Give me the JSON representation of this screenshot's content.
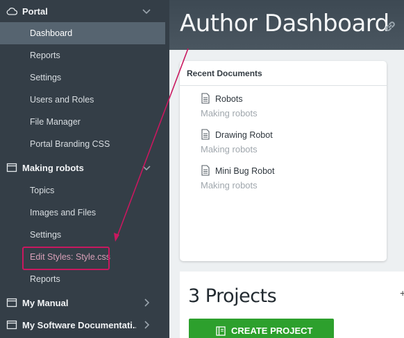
{
  "sidebar": {
    "sections": [
      {
        "label": "Portal",
        "icon": "cloud-icon",
        "expanded": true,
        "items": [
          "Dashboard",
          "Reports",
          "Settings",
          "Users and Roles",
          "File Manager",
          "Portal Branding CSS"
        ]
      },
      {
        "label": "Making robots",
        "icon": "book-icon",
        "expanded": true,
        "items": [
          "Topics",
          "Images and Files",
          "Settings",
          "Edit Styles: Style.css",
          "Reports"
        ]
      },
      {
        "label": "My Manual",
        "icon": "book-icon",
        "expanded": false,
        "items": []
      },
      {
        "label": "My Software Documentati...",
        "icon": "book-icon",
        "expanded": false,
        "items": []
      }
    ],
    "active_item": "Dashboard",
    "highlighted_item": "Edit Styles: Style.css"
  },
  "main": {
    "title": "Author Dashboard",
    "recent": {
      "heading": "Recent Documents",
      "docs": [
        {
          "name": "Robots",
          "project": "Making robots"
        },
        {
          "name": "Drawing Robot",
          "project": "Making robots"
        },
        {
          "name": "Mini Bug Robot",
          "project": "Making robots"
        }
      ]
    },
    "projects": {
      "count_label": "3 Projects",
      "create_label": "CREATE PROJECT"
    }
  },
  "colors": {
    "sidebar_bg": "#343e47",
    "active_bg": "#566470",
    "highlight": "#c9185f",
    "primary_button": "#2da02d"
  }
}
